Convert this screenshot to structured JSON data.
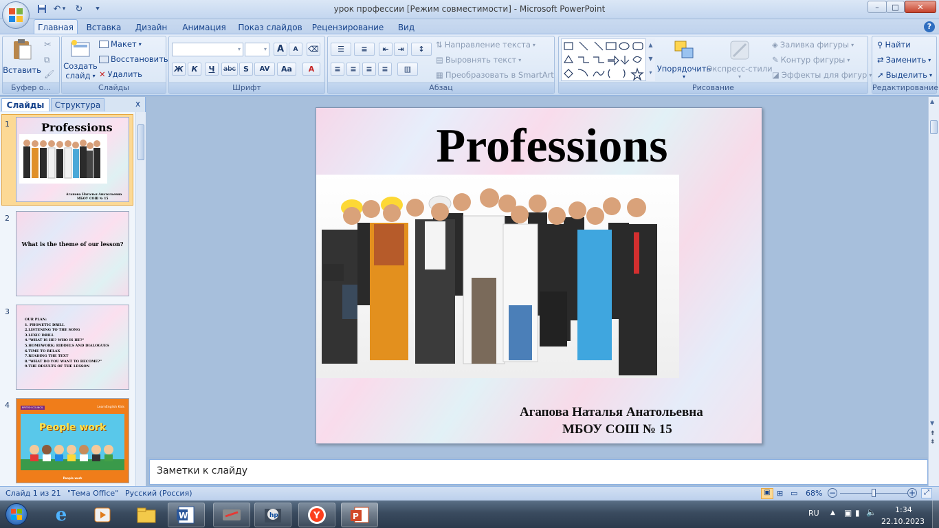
{
  "window": {
    "title": "урок профессии [Режим совместимости] - Microsoft PowerPoint",
    "min": "–",
    "max": "□",
    "close": "✕"
  },
  "ribbon_tabs": [
    "Главная",
    "Вставка",
    "Дизайн",
    "Анимация",
    "Показ слайдов",
    "Рецензирование",
    "Вид"
  ],
  "clipboard": {
    "paste": "Вставить",
    "label": "Буфер о..."
  },
  "slides_group": {
    "new_slide": "Создать",
    "new_slide2": "слайд",
    "layout": "Макет",
    "reset": "Восстановить",
    "delete": "Удалить",
    "label": "Слайды"
  },
  "font_group": {
    "label": "Шрифт",
    "b": "Ж",
    "i": "К",
    "u": "Ч",
    "s": "abc",
    "sh": "S",
    "sp": "AV",
    "case": "Aa",
    "color": "A",
    "grow": "A",
    "shrink": "A"
  },
  "paragraph_group": {
    "label": "Абзац",
    "dir": "Направление текста",
    "align": "Выровнять текст",
    "smartart": "Преобразовать в SmartArt"
  },
  "drawing_group": {
    "label": "Рисование",
    "arrange": "Упорядочить",
    "styles": "Экспресс-стили",
    "fill": "Заливка фигуры",
    "outline": "Контур фигуры",
    "effects": "Эффекты для фигур"
  },
  "editing_group": {
    "label": "Редактирование",
    "find": "Найти",
    "replace": "Заменить",
    "select": "Выделить"
  },
  "panel": {
    "tab_slides": "Слайды",
    "tab_outline": "Структура",
    "close": "x"
  },
  "thumbnails": [
    {
      "num": "1",
      "title": "Professions",
      "author": "Агапова Наталья Анатольевна",
      "school": "МБОУ СОШ № 15"
    },
    {
      "num": "2",
      "title": "What is the theme of our lesson?"
    },
    {
      "num": "3",
      "lines": [
        "OUR PLAN:",
        "1. PHONETIC DRILL",
        "2.LISTENING TO THE SONG",
        "3.LEXIC DRILL",
        "4.\"WHAT IS HE? WHO IS HE?\"",
        "5.HOMEWORK: RIDDELS AND DIALOGUES",
        "6.TIME TO RELAX",
        "7.READING THE TEXT",
        "8.\"WHAT DO YOU WANT TO BECOME?\"",
        "9.THE RESULTS OF THE LESSON"
      ]
    },
    {
      "num": "4",
      "brand": "BRITISH COUNCIL",
      "site": "LearnEnglish Kids",
      "title": "People work",
      "caption": "People work"
    }
  ],
  "slide": {
    "title": "Professions",
    "author": "Агапова Наталья Анатольевна",
    "school": "МБОУ СОШ № 15"
  },
  "notes_placeholder": "Заметки к слайду",
  "status": {
    "slide": "Слайд 1 из 21",
    "theme": "\"Тема Office\"",
    "lang": "Русский (Россия)",
    "zoom": "68%",
    "zoom_level": 0.5
  },
  "taskbar": {
    "lang": "RU",
    "time": "1:34",
    "date": "22.10.2023"
  }
}
